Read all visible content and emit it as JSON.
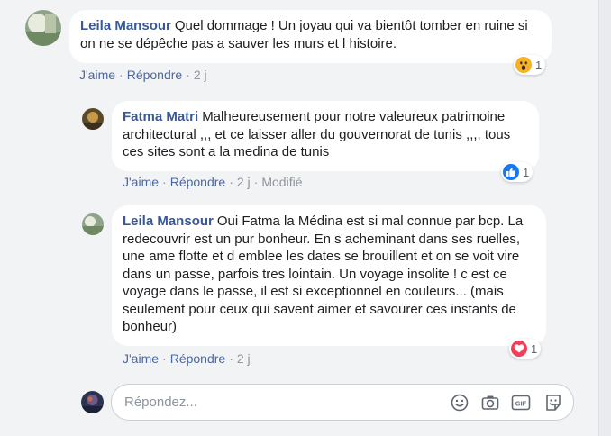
{
  "comments": [
    {
      "author": "Leila Mansour",
      "text": "Quel dommage ! Un joyau qui va bientôt tomber en ruine si on ne se dépêche pas a sauver les murs et l histoire.",
      "like_label": "J'aime",
      "reply_label": "Répondre",
      "time": "2 j",
      "reaction_icon": "wow-reaction-icon",
      "reaction_count": "1"
    },
    {
      "author": "Fatma Matri",
      "text": "Malheureusement pour notre valeureux patrimoine architectural ,,, et ce laisser aller du gouvernorat de tunis ,,,, tous ces sites sont a la medina de tunis",
      "like_label": "J'aime",
      "reply_label": "Répondre",
      "time": "2 j",
      "edited_label": "Modifié",
      "reaction_icon": "like-reaction-icon",
      "reaction_count": "1"
    },
    {
      "author": "Leila Mansour",
      "text": "Oui Fatma la Médina est si mal connue par bcp. La redecouvrir est un pur bonheur. En s acheminant dans ses ruelles, une ame flotte et d emblee les dates se brouillent et on se voit vire dans un passe, parfois tres lointain. Un voyage insolite ! c est ce voyage dans le passe, il est si exceptionnel en couleurs... (mais seulement pour ceux qui savent aimer et savourer ces instants de bonheur)",
      "like_label": "J'aime",
      "reply_label": "Répondre",
      "time": "2 j",
      "reaction_icon": "love-reaction-icon",
      "reaction_count": "1"
    }
  ],
  "reply_box": {
    "placeholder": "Répondez...",
    "icons": [
      "emoji-icon",
      "camera-icon",
      "gif-icon",
      "sticker-icon"
    ]
  },
  "colors": {
    "author": "#385898",
    "link": "#4b67a1",
    "like_blue": "#1877f2",
    "love_red": "#f33e58",
    "wow_yellow": "#f7b125"
  }
}
